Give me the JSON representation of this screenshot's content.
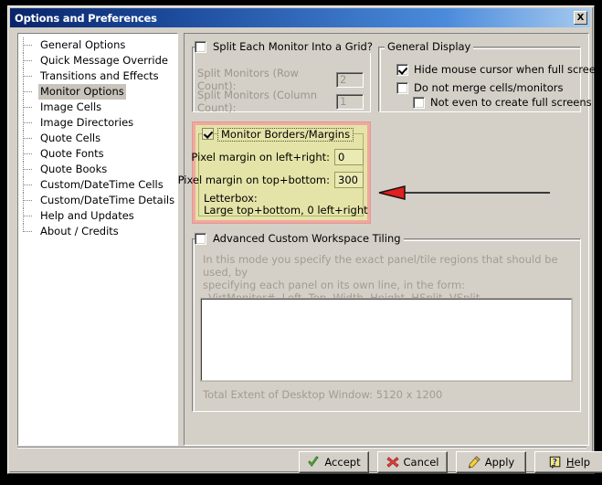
{
  "window": {
    "title": "Options and Preferences",
    "close_label": "X"
  },
  "sidebar": {
    "items": [
      {
        "label": "General Options",
        "selected": false
      },
      {
        "label": "Quick Message Override",
        "selected": false
      },
      {
        "label": "Transitions and Effects",
        "selected": false
      },
      {
        "label": "Monitor Options",
        "selected": true
      },
      {
        "label": "Image Cells",
        "selected": false
      },
      {
        "label": "Image Directories",
        "selected": false
      },
      {
        "label": "Quote Cells",
        "selected": false
      },
      {
        "label": "Quote Fonts",
        "selected": false
      },
      {
        "label": "Quote Books",
        "selected": false
      },
      {
        "label": "Custom/DateTime Cells",
        "selected": false
      },
      {
        "label": "Custom/DateTime Details",
        "selected": false
      },
      {
        "label": "Help and Updates",
        "selected": false
      },
      {
        "label": "About / Credits",
        "selected": false
      }
    ]
  },
  "split_group": {
    "title": "Split Each Monitor Into a Grid?",
    "checked": false,
    "row_count_label": "Split Monitors (Row Count):",
    "row_count_value": "2",
    "column_count_label": "Split Monitors (Column Count):",
    "column_count_value": "1"
  },
  "general_display": {
    "title": "General Display",
    "hide_cursor_label": "Hide mouse cursor when full screen",
    "hide_cursor_checked": true,
    "no_merge_label": "Do not merge cells/monitors",
    "no_merge_checked": false,
    "not_even_label": "Not even to create full screens",
    "not_even_checked": false
  },
  "borders_group": {
    "title": "Monitor Borders/Margins",
    "checked": true,
    "left_right_label": "Pixel margin on left+right:",
    "left_right_value": "0",
    "top_bottom_label": "Pixel margin on top+bottom:",
    "top_bottom_value": "300",
    "note_line1": "Letterbox:",
    "note_line2": "Large top+bottom, 0 left+right",
    "highlight_border_color": "#f0a8a0",
    "highlight_fill_color": "#e4e4a8"
  },
  "annotation": {
    "arrow_color": "#e02020",
    "arrow_direction": "left"
  },
  "advanced_tiling": {
    "title": "Advanced Custom Workspace Tiling",
    "checked": false,
    "help_line1": "In this mode you specify the exact panel/tile regions that should be used, by",
    "help_line2": "specifying each panel on its own line, in the form:",
    "help_line3": "VirtMonitor#, Left, Top, Width, Height, HSplit, VSplit [,OPTIONALFLAGS]",
    "textarea_value": "",
    "total_extent": "Total Extent of Desktop Window: 5120 x 1200"
  },
  "buttons": [
    {
      "label": "Accept",
      "icon": "check-icon"
    },
    {
      "label": "Cancel",
      "icon": "x-icon"
    },
    {
      "label": "Apply",
      "icon": "pencil-icon"
    },
    {
      "label": "Help",
      "icon": "question-icon",
      "accel": "H"
    }
  ]
}
